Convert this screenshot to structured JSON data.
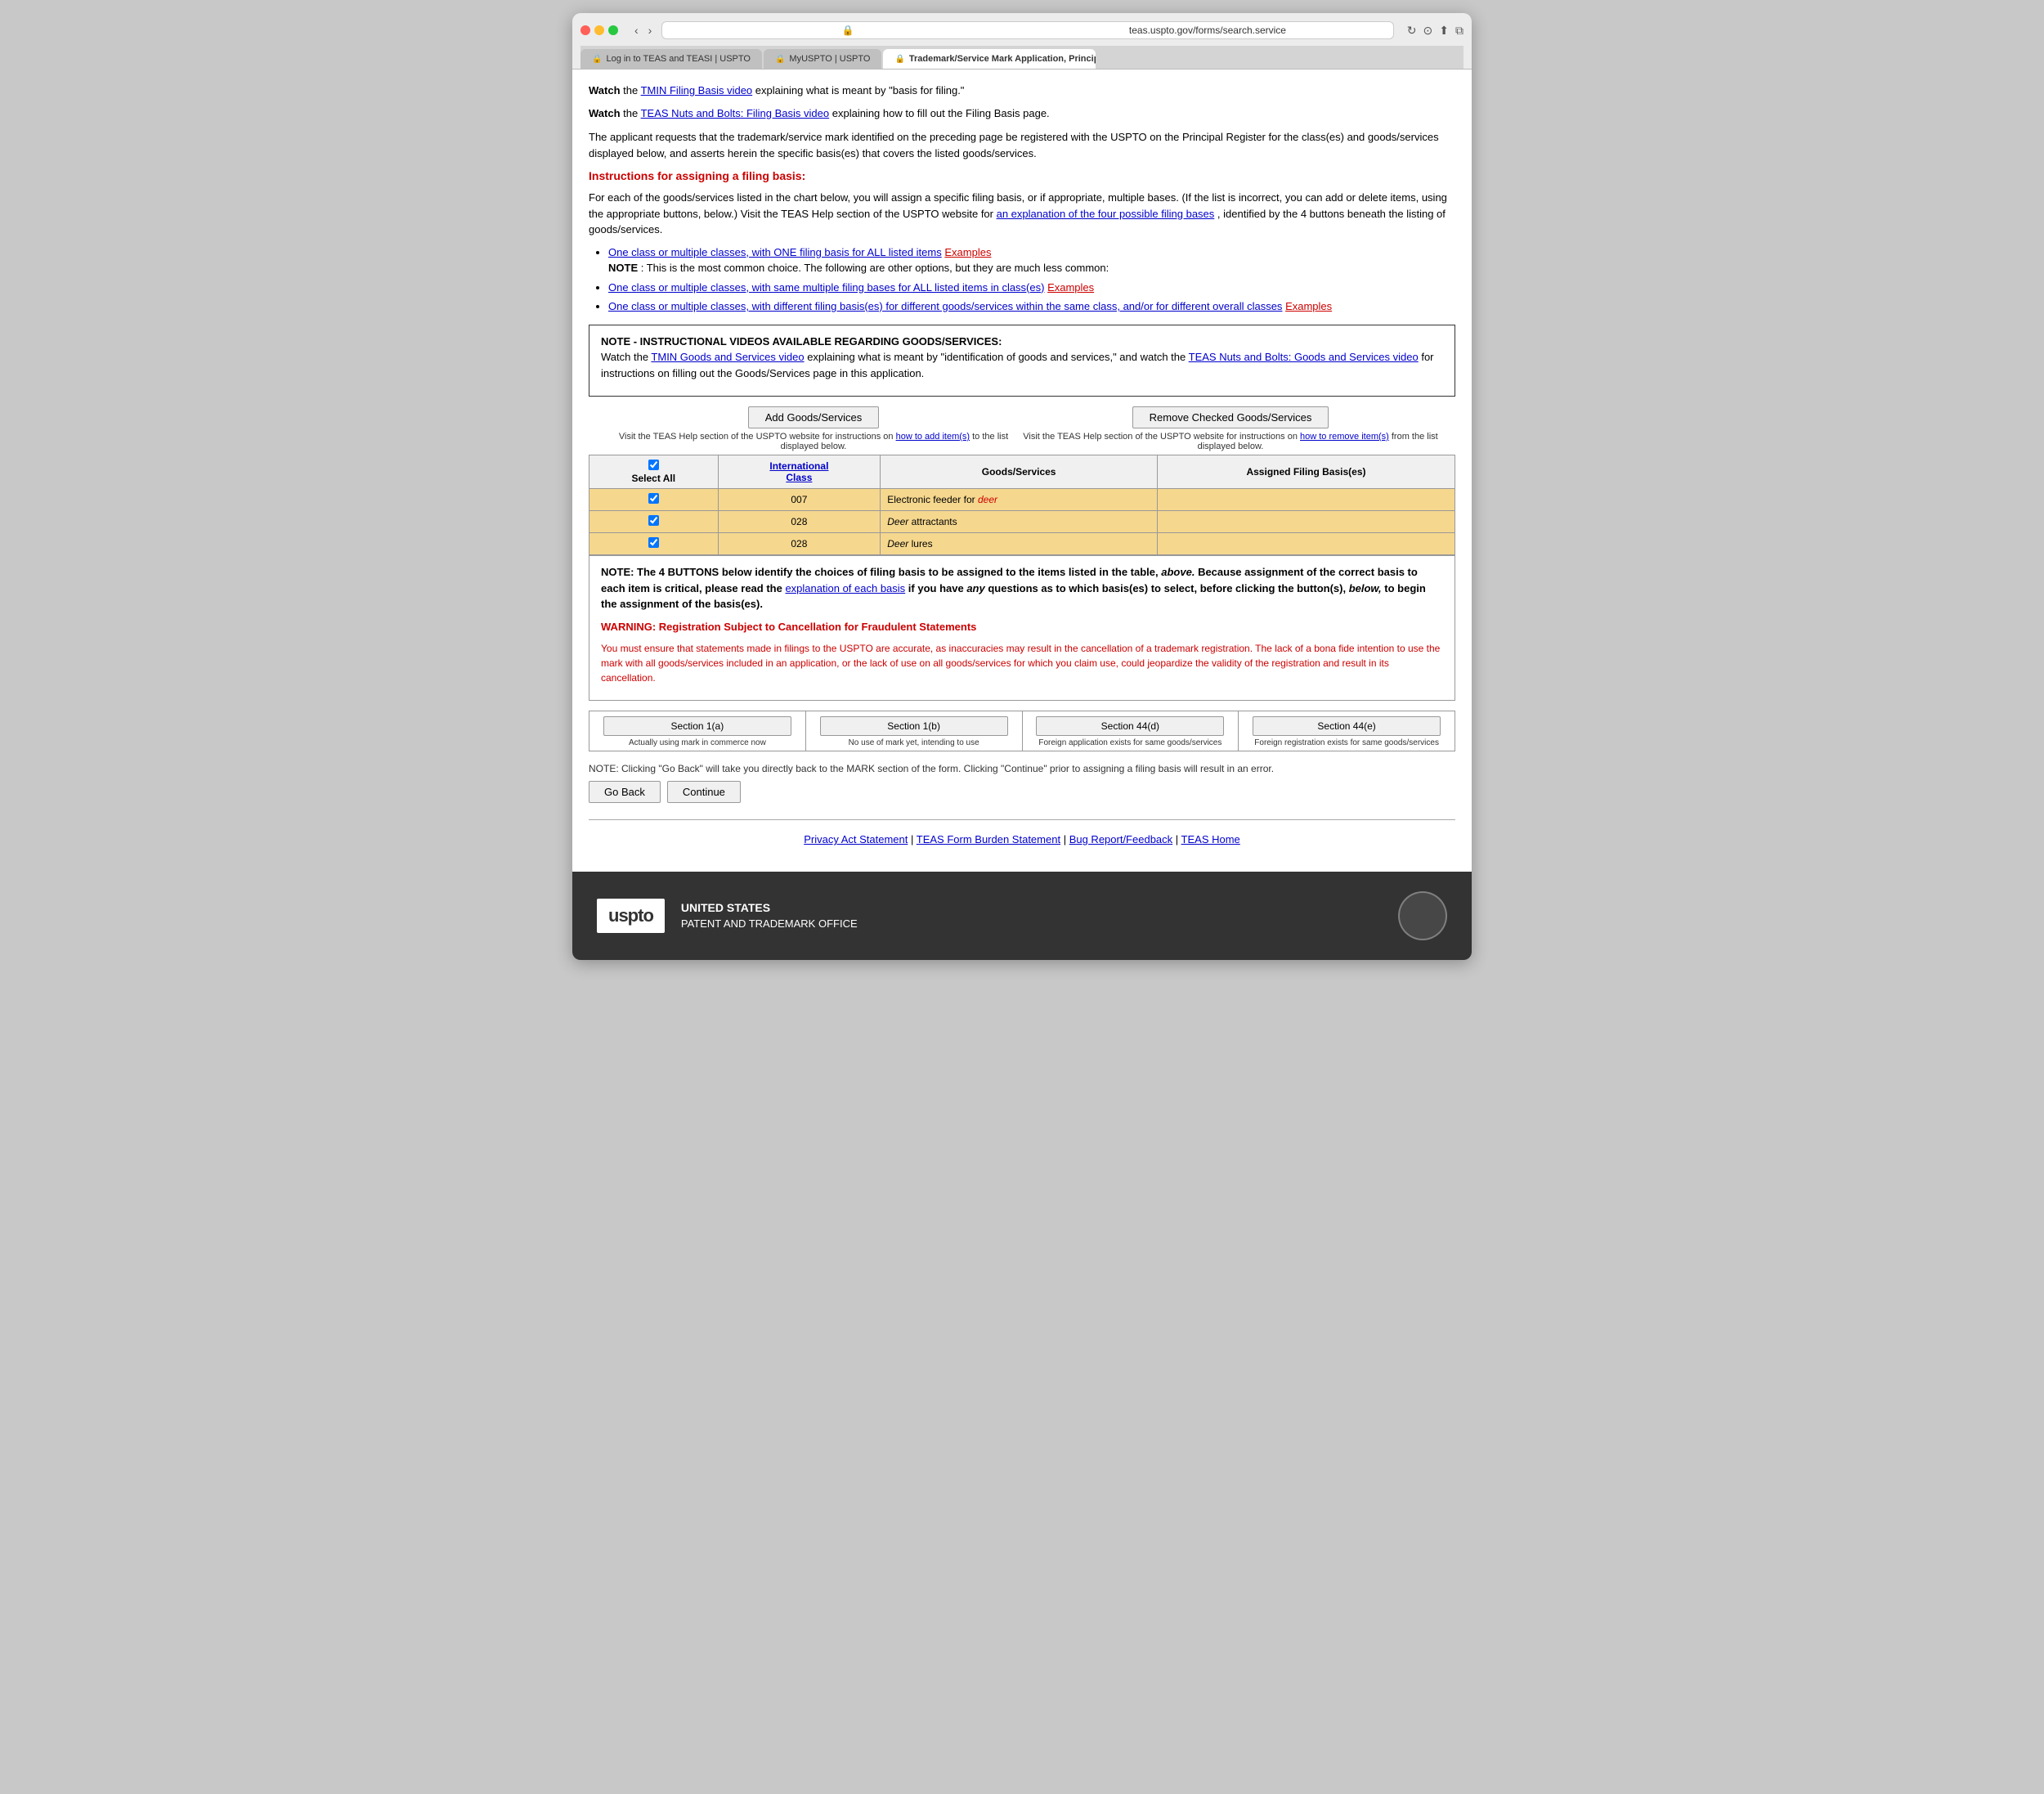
{
  "browser": {
    "url": "teas.uspto.gov/forms/search.service",
    "tabs": [
      {
        "id": "tab1",
        "label": "Log in to TEAS and TEASI | USPTO",
        "active": false,
        "favicon": "🔒"
      },
      {
        "id": "tab2",
        "label": "MyUSPTO | USPTO",
        "active": false,
        "favicon": "🔒"
      },
      {
        "id": "tab3",
        "label": "Trademark/Service Mark Application, Principal Register",
        "active": true,
        "favicon": "🔒"
      }
    ]
  },
  "page": {
    "watch_text1": "Watch the ",
    "watch_link1": "TMIN Filing Basis video",
    "watch_text1b": " explaining what is meant by \"basis for filing.\"",
    "watch_text2": "Watch the ",
    "watch_link2": "TEAS Nuts and Bolts: Filing Basis video",
    "watch_text2b": " explaining how to fill out the Filing Basis page.",
    "intro_para": "The applicant requests that the trademark/service mark identified on the preceding page be registered with the USPTO on the Principal Register for the class(es) and goods/services displayed below, and asserts herein the specific basis(es) that covers the listed goods/services.",
    "instructions_title": "Instructions for assigning a filing basis:",
    "instructions_para": "For each of the goods/services listed in the chart below, you will assign a specific filing basis, or if appropriate, multiple bases. (If the list is incorrect, you can add or delete items, using the appropriate buttons, below.) Visit the TEAS Help section of the USPTO website for ",
    "instructions_link": "an explanation of the four possible filing bases",
    "instructions_para2": ", identified by the 4 buttons beneath the listing of goods/services.",
    "bullet1_link": "One class or multiple classes, with ONE filing basis for ALL listed items",
    "bullet1_link2": "Examples",
    "bullet1_note": "NOTE",
    "bullet1_note_text": ": This is the most common choice. The following are other options, but they are much less common:",
    "bullet2_link": "One class or multiple classes, with same multiple filing bases for ALL listed items in class(es)",
    "bullet2_link2": "Examples",
    "bullet3_link": "One class or multiple classes, with different filing basis(es) for different goods/services within the same class, and/or for different overall classes",
    "bullet3_link2": "Examples",
    "note_box": {
      "title": "NOTE - INSTRUCTIONAL VIDEOS AVAILABLE REGARDING GOODS/SERVICES:",
      "text1": "Watch the ",
      "link1": "TMIN Goods and Services video",
      "text2": " explaining what is meant by \"identification of goods and services,\" and watch the ",
      "link2": "TEAS Nuts and Bolts: Goods and Services video",
      "text3": " for instructions on filling out the Goods/Services page in this application."
    },
    "add_btn": "Add Goods/Services",
    "remove_btn": "Remove Checked Goods/Services",
    "add_help_text1": "Visit the TEAS Help section of the USPTO website for instructions on ",
    "add_help_link": "how to add item(s)",
    "add_help_text2": " to the list displayed below.",
    "remove_help_text1": "Visit the TEAS Help section of the USPTO website for instructions on ",
    "remove_help_link": "how to remove item(s)",
    "remove_help_text2": " from the list displayed below.",
    "table": {
      "col_select": "Select All",
      "col_int_class": "International Class",
      "col_goods": "Goods/Services",
      "col_assigned": "Assigned Filing Basis(es)",
      "rows": [
        {
          "checked": true,
          "class": "007",
          "goods": "Electronic feeder for ",
          "goods_italic": "deer",
          "assigned": ""
        },
        {
          "checked": true,
          "class": "028",
          "goods": "",
          "goods_italic": "Deer",
          "goods_after": " attractants",
          "assigned": ""
        },
        {
          "checked": true,
          "class": "028",
          "goods": "",
          "goods_italic": "Deer",
          "goods_after": " lures",
          "assigned": ""
        }
      ]
    },
    "warning_box": {
      "text1": "NOTE: The 4 BUTTONS below identify the choices of filing basis to be assigned to the items listed in the table, ",
      "text1_italic": "above.",
      "text2": " Because assignment of the correct basis to each item is critical, please read the ",
      "link": "explanation of each basis",
      "text3": " if you have ",
      "text3_italic": "any",
      "text4": " questions as to which basis(es) to select, before clicking the button(s), ",
      "text4_italic": "below,",
      "text5": " to begin the assignment of the basis(es).",
      "warning_title": "WARNING: Registration Subject to Cancellation for Fraudulent Statements",
      "warning_text": "You must ensure that statements made in filings to the USPTO are accurate, as inaccuracies may result in the cancellation of a trademark registration. The lack of a bona fide intention to use the mark with all goods/services included in an application, or the lack of use on all goods/services for which you claim use, could jeopardize the validity of the registration and result in its cancellation."
    },
    "section_buttons": [
      {
        "label": "Section 1(a)",
        "desc": "Actually using mark in commerce now"
      },
      {
        "label": "Section 1(b)",
        "desc": "No use of mark yet, intending to use"
      },
      {
        "label": "Section 44(d)",
        "desc": "Foreign application exists for same goods/services"
      },
      {
        "label": "Section 44(e)",
        "desc": "Foreign registration exists for same goods/services"
      }
    ],
    "bottom_note": "NOTE: Clicking \"Go Back\" will take you directly back to the MARK section of the form. Clicking \"Continue\" prior to assigning a filing basis will result in an error.",
    "go_back_btn": "Go Back",
    "continue_btn": "Continue",
    "footer_links": [
      {
        "label": "Privacy Act Statement",
        "sep": " | "
      },
      {
        "label": "TEAS Form Burden Statement",
        "sep": " | "
      },
      {
        "label": "Bug Report/Feedback",
        "sep": " | "
      },
      {
        "label": "TEAS Home",
        "sep": ""
      }
    ],
    "uspto_footer": {
      "logo": "uspto",
      "line1": "UNITED STATES",
      "line2": "PATENT AND TRADEMARK OFFICE"
    }
  }
}
